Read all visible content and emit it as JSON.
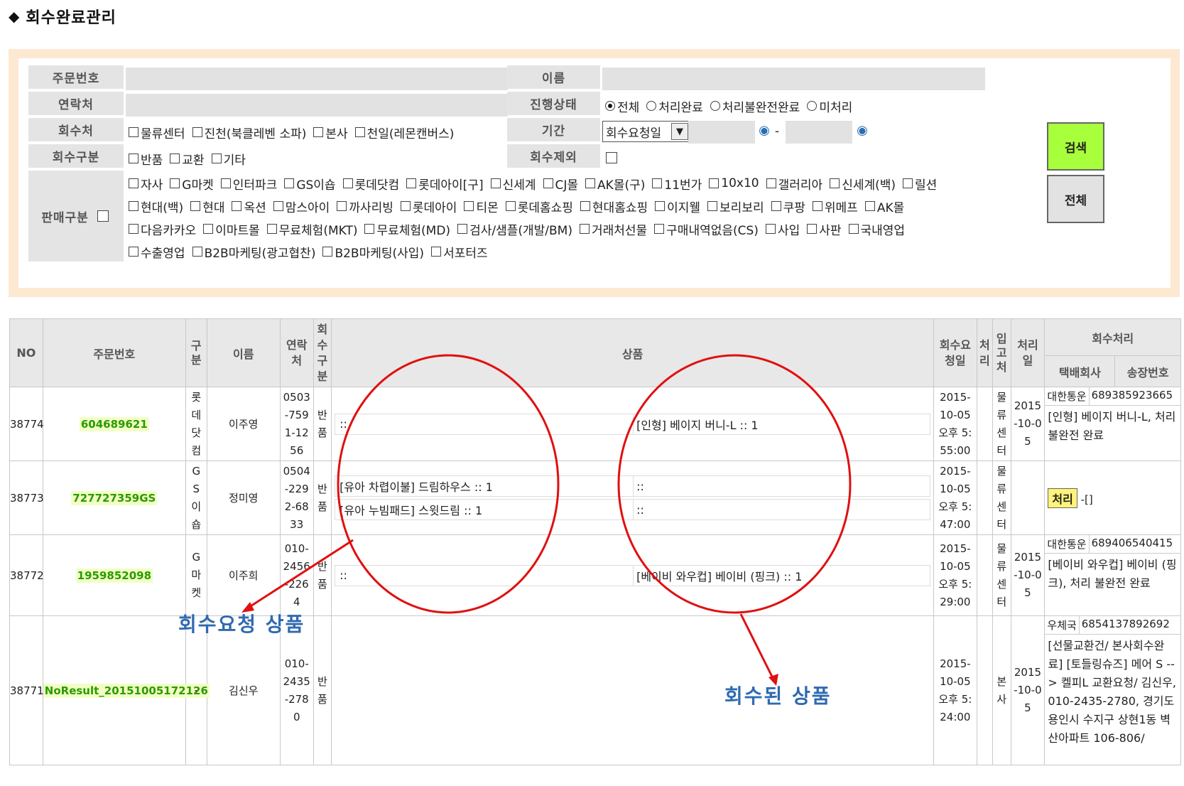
{
  "page": {
    "title": "회수완료관리"
  },
  "search": {
    "order_no_label": "주문번호",
    "name_label": "이름",
    "contact_label": "연락처",
    "status_label": "진행상태",
    "status_options": [
      "전체",
      "처리완료",
      "처리불완전완료",
      "미처리"
    ],
    "status_selected": "전체",
    "pickup_label": "회수처",
    "pickup_options": [
      "물류센터",
      "진천(북클레벤 소파)",
      "본사",
      "천일(레몬캔버스)"
    ],
    "period_label": "기간",
    "period_select": "회수요청일",
    "period_sep": "-",
    "type_label": "회수구분",
    "type_options": [
      "반품",
      "교환",
      "기타"
    ],
    "exclude_label": "회수제외",
    "sales_label": "판매구분",
    "sales_rows": [
      [
        "자사",
        "G마켓",
        "인터파크",
        "GS이숍",
        "롯데닷컴",
        "롯데아이[구]",
        "신세계",
        "CJ몰",
        "AK몰(구)",
        "11번가",
        "10x10",
        "갤러리아",
        "신세계(백)",
        "릴션"
      ],
      [
        "현대(백)",
        "현대",
        "옥션",
        "맘스아이",
        "까사리빙",
        "롯데아이",
        "티몬",
        "롯데홈쇼핑",
        "현대홈쇼핑",
        "이지웰",
        "보리보리",
        "쿠팡",
        "위메프",
        "AK몰"
      ],
      [
        "다음카카오",
        "이마트몰",
        "무료체험(MKT)",
        "무료체험(MD)",
        "검사/샘플(개발/BM)",
        "거래처선물",
        "구매내역없음(CS)",
        "사입",
        "사판",
        "국내영업"
      ],
      [
        "수출영업",
        "B2B마케팅(광고협찬)",
        "B2B마케팅(사입)",
        "서포터즈"
      ]
    ],
    "search_button": "검색",
    "all_button": "전체"
  },
  "table": {
    "headers": {
      "no": "NO",
      "order": "주문번호",
      "type": "구분",
      "name": "이름",
      "contact": "연락처",
      "return_type": "회수구분",
      "product": "상품",
      "req_date": "회수요청일",
      "handled": "처리",
      "inbound": "입고처",
      "proc_date": "처리일",
      "process": "회수처리",
      "courier": "택배회사",
      "invoice": "송장번호"
    },
    "rows": [
      {
        "no": "38774",
        "order": "604689621",
        "type": "롯데닷컴",
        "name": "이주영",
        "contact": "0503-7591-1256",
        "return_type": "반품",
        "products": [
          {
            "req": "::",
            "ret": "[인형] 베이지 버니-L :: 1"
          }
        ],
        "req_date": "2015-10-05 오후 5:55:00",
        "handled": "",
        "inbound": "물류센터",
        "proc_date": "2015-10-05",
        "courier": "대한통운",
        "invoice": "689385923665",
        "note": "[인형] 베이지 버니-L, 처리 불완전 완료"
      },
      {
        "no": "38773",
        "order": "727727359GS",
        "type": "GS이숍",
        "name": "정미영",
        "contact": "0504-2292-6833",
        "return_type": "반품",
        "products": [
          {
            "req": "[유아 차렵이불] 드림하우스 :: 1",
            "ret": "::"
          },
          {
            "req": "[유아 누빔패드] 스윗드림 :: 1",
            "ret": "::"
          }
        ],
        "req_date": "2015-10-05 오후 5:47:00",
        "handled": "",
        "inbound": "물류센터",
        "proc_date": "",
        "process_button": "처리",
        "process_suffix": "-[]"
      },
      {
        "no": "38772",
        "order": "1959852098",
        "type": "G마켓",
        "name": "이주희",
        "contact": "010-2456-2264",
        "return_type": "반품",
        "products": [
          {
            "req": "::",
            "ret": "[베이비 와우컵] 베이비 (핑크) :: 1"
          }
        ],
        "req_date": "2015-10-05 오후 5:29:00",
        "handled": "",
        "inbound": "물류센터",
        "proc_date": "2015-10-05",
        "courier": "대한통운",
        "invoice": "689406540415",
        "note": "[베이비 와우컵] 베이비 (핑크), 처리 불완전 완료"
      },
      {
        "no": "38771",
        "order": "NoResult_20151005172126",
        "type": "-",
        "name": "김신우",
        "contact": "010-2435-2780",
        "return_type": "반품",
        "products": [],
        "req_date": "2015-10-05 오후 5:24:00",
        "handled": "",
        "inbound": "본사",
        "proc_date": "2015-10-05",
        "courier": "우체국",
        "invoice": "6854137892692",
        "note": "[선물교환건/ 본사회수완료] [토들링슈즈] 메어 S --> 켈피L 교환요청/ 김신우, 010-2435-2780, 경기도 용인시 수지구 상현1동 벽산아파트 106-806/"
      }
    ]
  },
  "annotations": {
    "requested_label": "회수요청 상품",
    "returned_label": "회수된 상품",
    "color": "#e01010"
  }
}
